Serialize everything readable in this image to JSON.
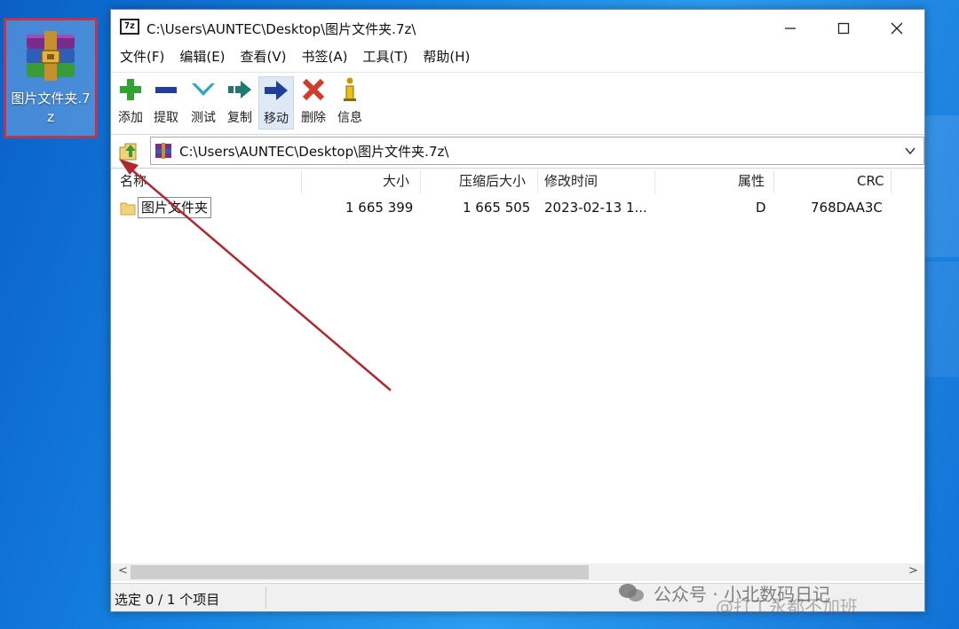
{
  "desktop": {
    "icon_label": "图片文件夹.7z"
  },
  "window": {
    "title": "C:\\Users\\AUNTEC\\Desktop\\图片文件夹.7z\\",
    "app_logo": "7z",
    "controls": {
      "minimize": "minimize-icon",
      "maximize": "maximize-icon",
      "close": "close-icon"
    }
  },
  "menu": [
    "文件(F)",
    "编辑(E)",
    "查看(V)",
    "书签(A)",
    "工具(T)",
    "帮助(H)"
  ],
  "toolbar": [
    {
      "label": "添加",
      "icon": "plus-icon",
      "color": "#2fa52f"
    },
    {
      "label": "提取",
      "icon": "minus-icon",
      "color": "#1f3f9a"
    },
    {
      "label": "测试",
      "icon": "check-chevron-icon",
      "color": "#2aa7c9"
    },
    {
      "label": "复制",
      "icon": "copy-arrow-icon",
      "color": "#1d7a6e"
    },
    {
      "label": "移动",
      "icon": "move-arrow-icon",
      "color": "#1f3f9a"
    },
    {
      "label": "删除",
      "icon": "delete-x-icon",
      "color": "#d23a2a"
    },
    {
      "label": "信息",
      "icon": "info-icon",
      "color": "#c99a00"
    }
  ],
  "address": {
    "path": "C:\\Users\\AUNTEC\\Desktop\\图片文件夹.7z\\"
  },
  "columns": [
    "名称",
    "大小",
    "压缩后大小",
    "修改时间",
    "属性",
    "CRC"
  ],
  "rows": [
    {
      "name": "图片文件夹",
      "size": "1 665 399",
      "packed": "1 665 505",
      "modified": "2023-02-13 1...",
      "attr": "D",
      "crc": "768DAA3C"
    }
  ],
  "status": {
    "selection": "选定 0 / 1 个项目"
  },
  "watermark": {
    "line1": "公众号 · 小北数码日记",
    "line2": "@打工永都不加班"
  },
  "colors": {
    "highlight_border": "#c0334d",
    "annotation_arrow": "#b3262e"
  }
}
